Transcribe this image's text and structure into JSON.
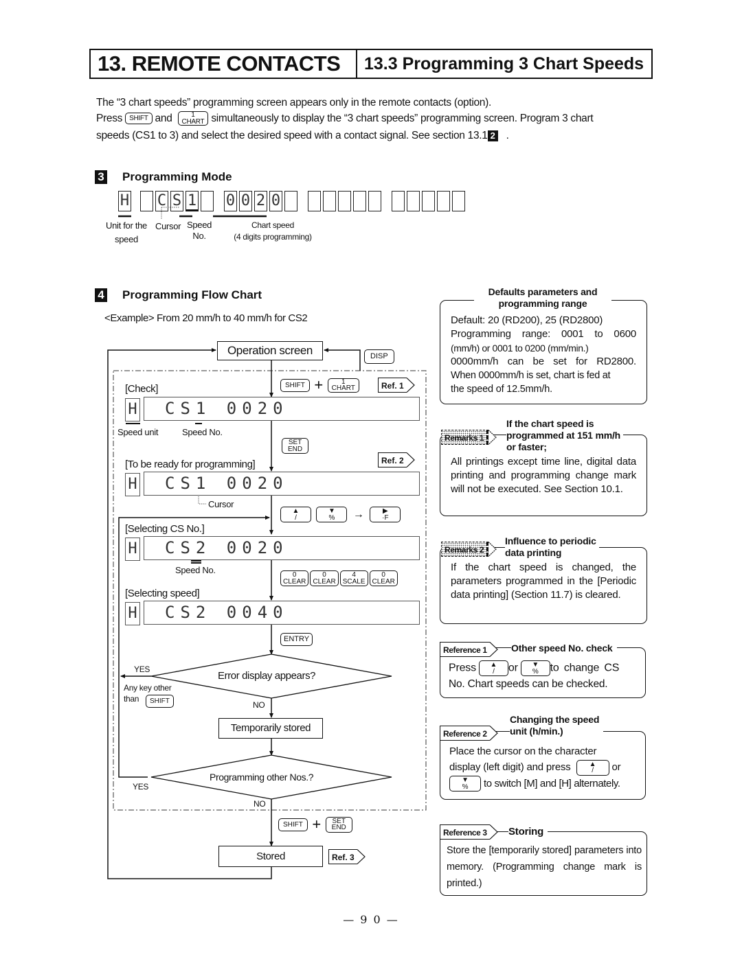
{
  "header": {
    "chapter": "13. REMOTE CONTACTS",
    "section": "13.3 Programming 3 Chart Speeds"
  },
  "intro": {
    "line1": "The “3 chart speeds” programming screen appears only in the remote contacts (option).",
    "line2_pre": "Press",
    "line2_and": "and",
    "line2_post": "simultaneously to display the “3 chart speeds” programming screen. Program 3 chart",
    "line3": "speeds (CS1 to 3) and select the desired speed with a contact signal. See section 13.1",
    "line3_badge": "2",
    "line3_end": "."
  },
  "keys": {
    "shift": "SHIFT",
    "chart_top": "1",
    "chart_bottom": "CHART",
    "disp": "DISP",
    "set": "SET",
    "end": "END",
    "up_arrow": "▲",
    "up_sub": "/",
    "down_arrow": "▼",
    "down_sub": "%",
    "right_arrow": "▶",
    "right_sub": "·F",
    "entry": "ENTRY",
    "digit_keys": [
      {
        "top": "0",
        "bottom": "CLEAR"
      },
      {
        "top": "0",
        "bottom": "CLEAR"
      },
      {
        "top": "4",
        "bottom": "SCALE"
      },
      {
        "top": "0",
        "bottom": "CLEAR"
      }
    ],
    "plus": "+",
    "arrow_right": "→"
  },
  "programming_mode": {
    "number": "3",
    "title": "Programming Mode",
    "display_cells": [
      "H",
      "",
      "C",
      "S",
      "1",
      "",
      "0",
      "0",
      "2",
      "0",
      "",
      "",
      "",
      "",
      "",
      "",
      "",
      "",
      "",
      "",
      ""
    ],
    "labels": {
      "unit_line1": "Unit for the",
      "unit_line2": "speed",
      "cursor": "Cursor",
      "speed_no_line1": "Speed",
      "speed_no_line2": "No.",
      "chart_speed_line1": "Chart speed",
      "chart_speed_line2": "(4 digits programming)"
    }
  },
  "flow_chart": {
    "number": "4",
    "title": "Programming Flow Chart",
    "example": "<Example> From 20 mm/h to 40 mm/h for CS2",
    "operation_screen": "Operation screen",
    "steps": [
      {
        "label": "[Check]",
        "unit": "H",
        "display": "CS1 0020",
        "ref": "Ref. 1"
      },
      {
        "label": "[To be ready for programming]",
        "unit": "H",
        "display": "CS1 0020",
        "ref": "Ref. 2"
      },
      {
        "label": "[Selecting CS No.]",
        "unit": "H",
        "display": "CS2 0020"
      },
      {
        "label": "[Selecting speed]",
        "unit": "H",
        "display": "CS2 0040"
      }
    ],
    "annotations": {
      "speed_unit": "Speed unit",
      "speed_no": "Speed No.",
      "cursor": "Cursor",
      "speed_no_2": "Speed No."
    },
    "decision1": {
      "text": "Error display appears?",
      "yes": "YES",
      "no": "NO",
      "note_line1": "Any key other",
      "note_line2": "than"
    },
    "temporarily_stored": "Temporarily stored",
    "decision2": {
      "text": "Programming other Nos.?",
      "yes": "YES",
      "no": "NO"
    },
    "stored": "Stored",
    "ref3": "Ref. 3"
  },
  "panels": {
    "defaults": {
      "title_line1": "Defaults parameters and",
      "title_line2": "programming range",
      "lines": [
        "Default: 20 (RD200), 25 (RD2800)",
        "Programming range: 0001 to 0600",
        "(mm/h) or 0001 to 0200 (mm/min.)",
        "0000mm/h can be set for RD2800.",
        "When 0000mm/h is set, chart is fed at",
        "the speed of 12.5mm/h."
      ]
    },
    "remarks1": {
      "tag": "Remarks 1",
      "title_line1": "If the chart speed is",
      "title_line2": "programmed at 151 mm/h",
      "title_line3": "or faster;",
      "text": "All printings except time line, digital data printing and programming change mark will not be executed. See Section 10.1."
    },
    "remarks2": {
      "tag": "Remarks 2",
      "title_line1": "Influence to periodic",
      "title_line2": "data printing",
      "text": "If the chart speed is changed, the parameters programmed in the [Periodic data printing] (Section 11.7) is cleared."
    },
    "reference1": {
      "tag": "Reference 1",
      "title": "Other speed No. check",
      "pre": "Press",
      "or": "or",
      "post": "to change CS",
      "line2": "No. Chart speeds can be checked."
    },
    "reference2": {
      "tag": "Reference 2",
      "title_line1": "Changing the speed",
      "title_line2": "unit (h/min.)",
      "line1": "Place the cursor on the character",
      "line2_pre": "display (left digit) and press",
      "line2_post": "or",
      "line3": "to switch [M] and [H] alternately."
    },
    "reference3": {
      "tag": "Reference 3",
      "title": "Storing",
      "text": "Store the [temporarily stored] parameters into memory. (Programming change mark is printed.)"
    }
  },
  "page_number": "— 9 0 —"
}
